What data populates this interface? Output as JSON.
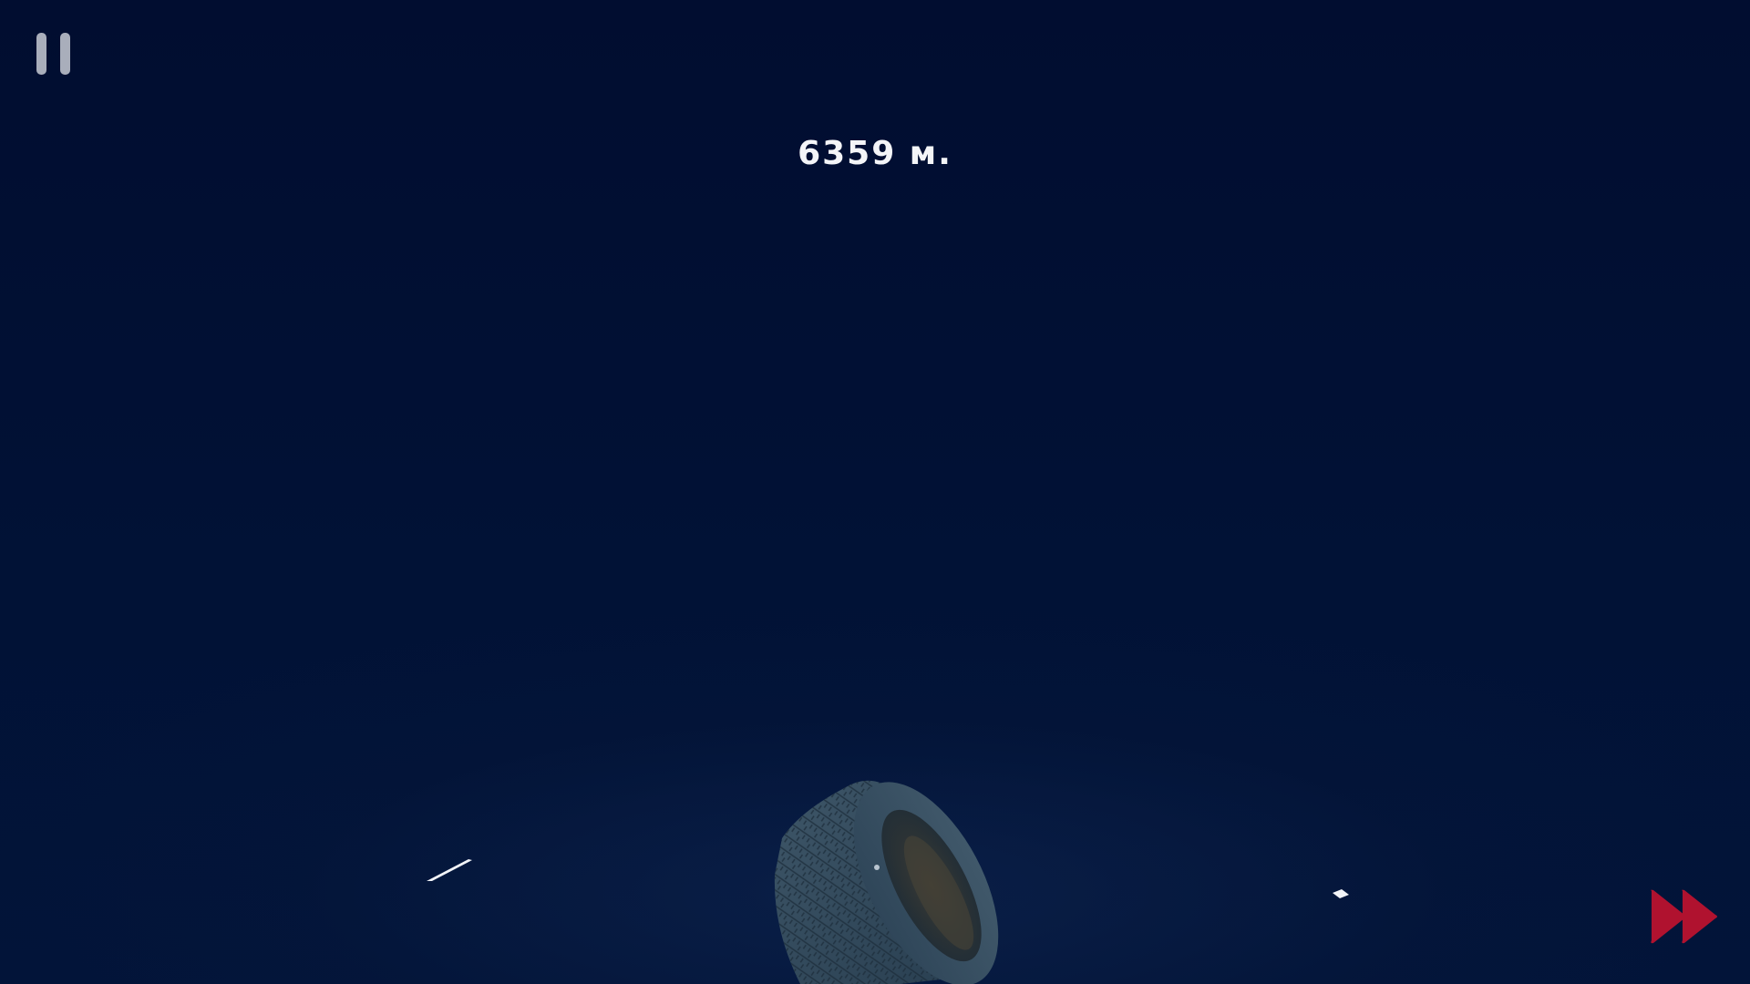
{
  "hud": {
    "distance_value": "6359",
    "distance_unit": "м.",
    "distance_text": "6359 м."
  },
  "controls": {
    "pause_icon": "pause-icon",
    "fast_forward_icon": "fast-forward-icon"
  },
  "colors": {
    "background": "#010f33",
    "pause_icon": "#a9aebb",
    "fast_forward": "#b0122f",
    "hud_text": "#f4f5f8"
  },
  "scene": {
    "objects": [
      "tire",
      "debris-streak",
      "debris-chip"
    ]
  }
}
